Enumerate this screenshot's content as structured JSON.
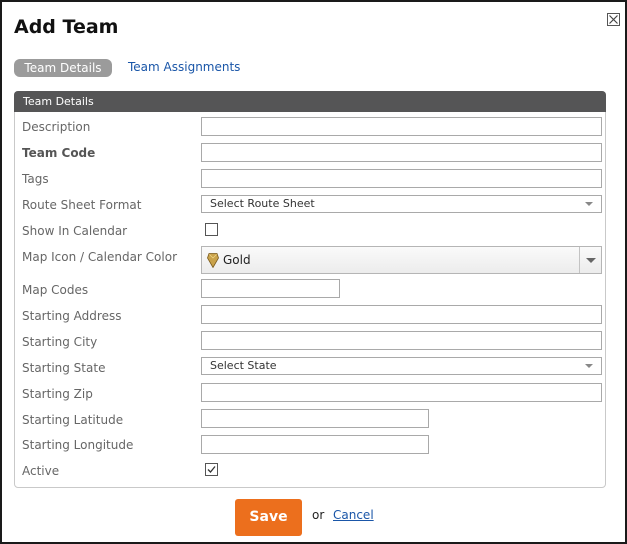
{
  "dialog": {
    "title": "Add Team"
  },
  "tabs": [
    {
      "label": "Team Details",
      "active": true
    },
    {
      "label": "Team Assignments",
      "active": false
    }
  ],
  "panel": {
    "header": "Team Details"
  },
  "fields": {
    "description": {
      "label": "Description",
      "value": ""
    },
    "team_code": {
      "label": "Team Code",
      "value": ""
    },
    "tags": {
      "label": "Tags",
      "value": ""
    },
    "route_sheet_format": {
      "label": "Route Sheet Format",
      "selected": "Select Route Sheet"
    },
    "show_in_calendar": {
      "label": "Show In Calendar",
      "checked": false
    },
    "map_icon_color": {
      "label": "Map Icon / Calendar Color",
      "selected": "Gold",
      "icon": "gold-gem-icon",
      "color": "#c9a24a"
    },
    "map_codes": {
      "label": "Map Codes",
      "value": ""
    },
    "starting_address": {
      "label": "Starting Address",
      "value": ""
    },
    "starting_city": {
      "label": "Starting City",
      "value": ""
    },
    "starting_state": {
      "label": "Starting State",
      "selected": "Select State"
    },
    "starting_zip": {
      "label": "Starting Zip",
      "value": ""
    },
    "starting_latitude": {
      "label": "Starting Latitude",
      "value": ""
    },
    "starting_longitude": {
      "label": "Starting Longitude",
      "value": ""
    },
    "active": {
      "label": "Active",
      "checked": true
    }
  },
  "footer": {
    "save_label": "Save",
    "or_text": "or",
    "cancel_label": "Cancel"
  },
  "colors": {
    "accent": "#ec6f1d",
    "header": "#555556",
    "link": "#1a56a8",
    "tab_active": "#9b9b9b"
  }
}
